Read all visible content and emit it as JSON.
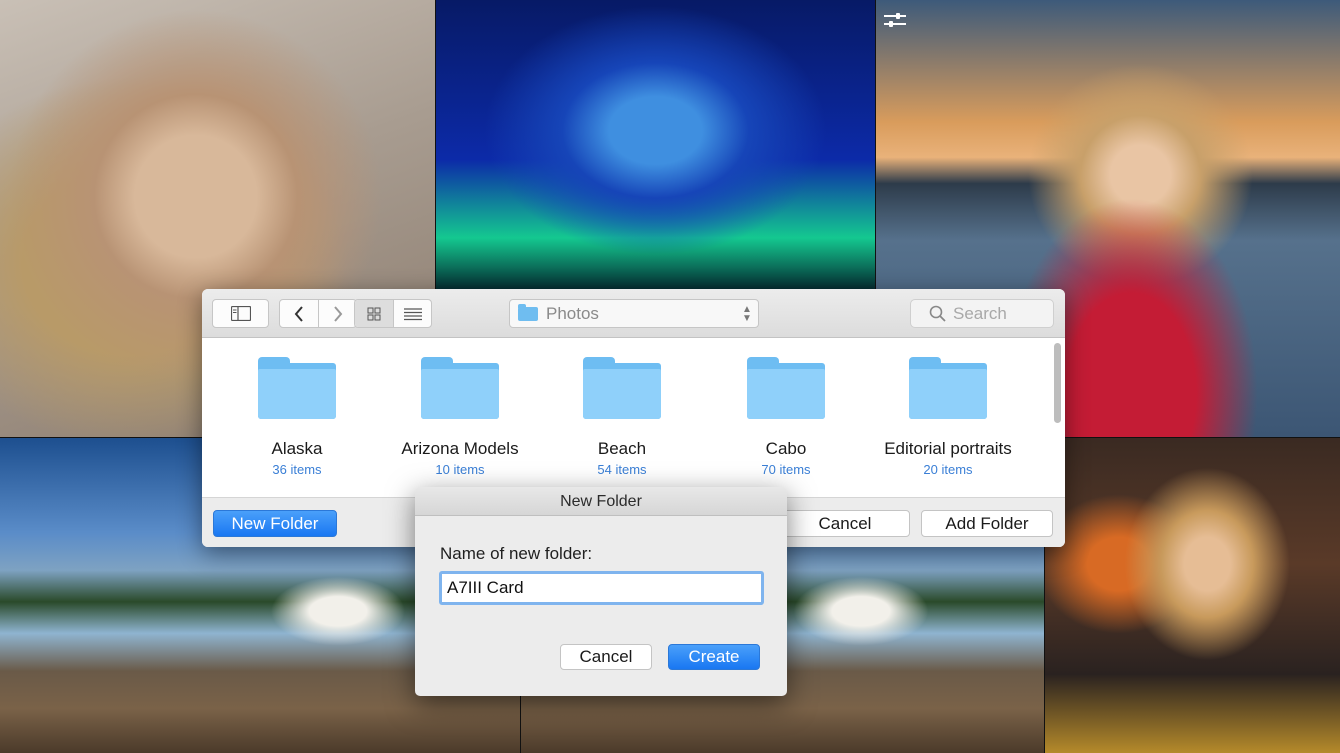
{
  "finder": {
    "location": "Photos",
    "search_placeholder": "Search",
    "folders": [
      {
        "name": "Alaska",
        "count": "36 items"
      },
      {
        "name": "Arizona Models",
        "count": "10 items"
      },
      {
        "name": "Beach",
        "count": "54 items"
      },
      {
        "name": "Cabo",
        "count": "70 items"
      },
      {
        "name": "Editorial portraits",
        "count": "20 items"
      }
    ],
    "new_folder_label": "New Folder",
    "cancel_label": "Cancel",
    "add_folder_label": "Add Folder"
  },
  "new_folder_sheet": {
    "title": "New Folder",
    "field_label": "Name of new folder:",
    "field_value": "A7III Card",
    "cancel_label": "Cancel",
    "create_label": "Create"
  },
  "colors": {
    "accent": "#1977f2",
    "folder": "#8fd0fa",
    "item_count": "#3a7fd6"
  }
}
